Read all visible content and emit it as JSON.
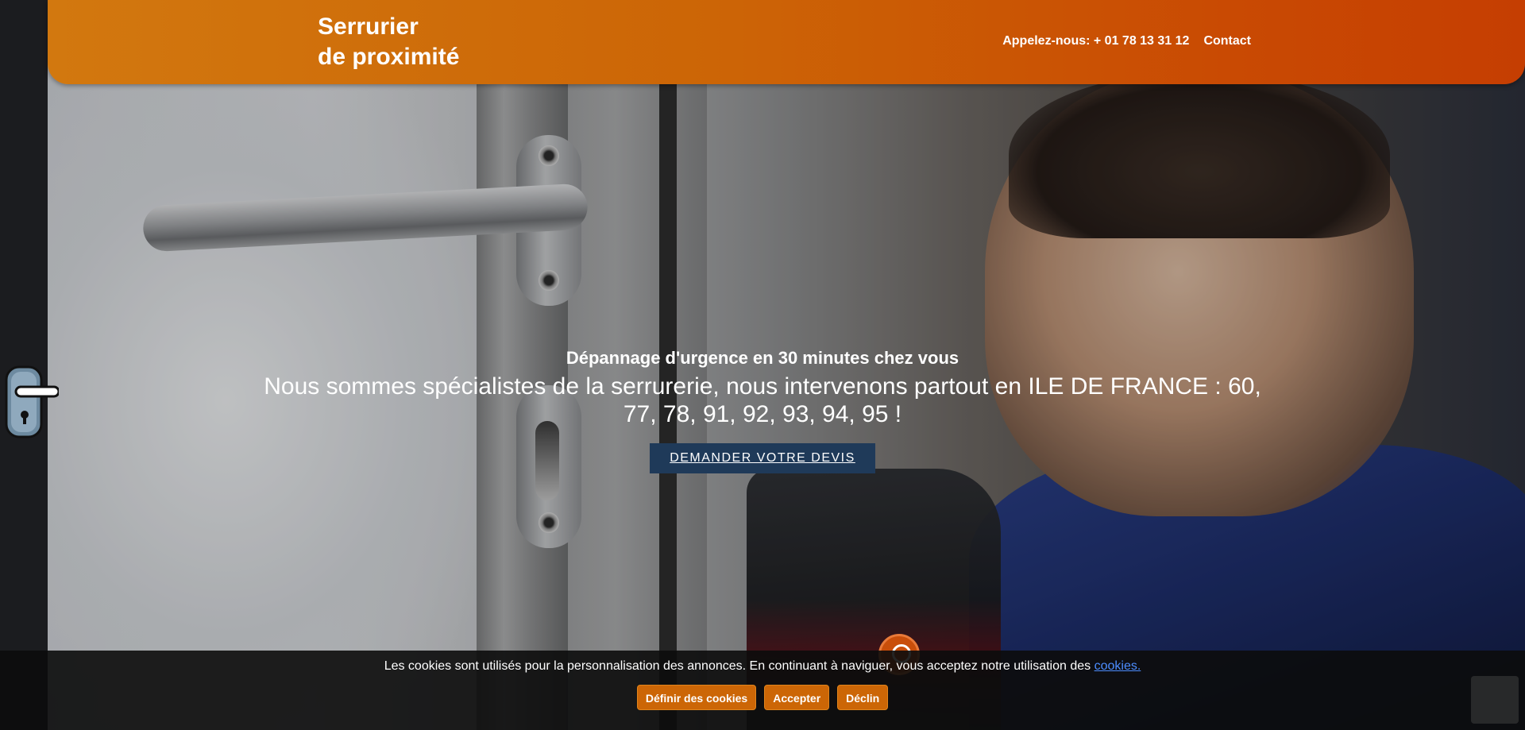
{
  "header": {
    "logo_line1": "Serrurier",
    "logo_line2": "de proximité",
    "phone_link": "Appelez-nous: + 01 78 13 31 12",
    "contact_link": "Contact"
  },
  "hero": {
    "subtitle": "Dépannage d'urgence en 30 minutes chez vous",
    "title": "Nous sommes spécialistes de la serrurerie, nous intervenons partout en ILE DE FRANCE : 60, 77, 78, 91, 92, 93, 94, 95 !",
    "cta_label": "DEMANDER VOTRE DEVIS"
  },
  "cookie_bar": {
    "text": "Les cookies sont utilisés pour la personnalisation des annonces. En continuant à naviguer, vous acceptez notre utilisation des",
    "link_label": "cookies.",
    "buttons": [
      "Définir des cookies",
      "Accepter",
      "Déclin"
    ]
  },
  "colors": {
    "header_start": "#d2780f",
    "header_end": "#c53e02",
    "cta_bg": "#1f3a59",
    "cookie_button": "#cc6606",
    "cookie_link": "#4c8dff"
  },
  "icons": [
    "door-handle-icon",
    "scroll-down-icon",
    "recaptcha-icon"
  ]
}
